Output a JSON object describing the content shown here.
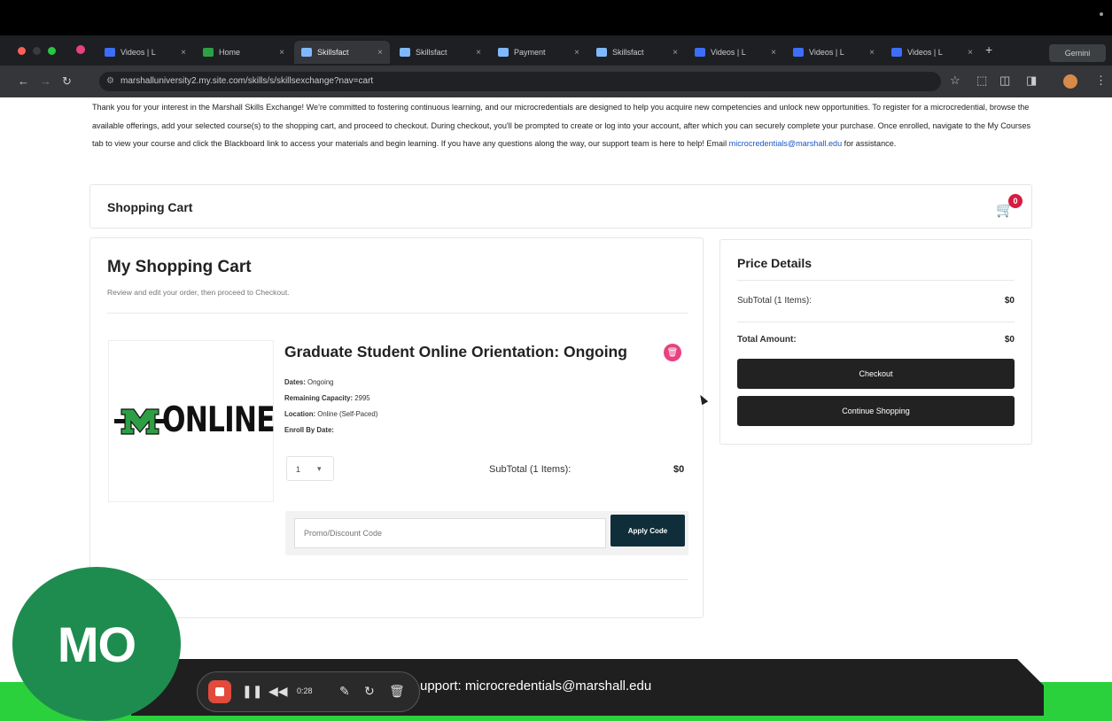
{
  "browser": {
    "tabs": [
      {
        "label": "Videos | L",
        "favicon_color": "#3d6ef7",
        "active": false
      },
      {
        "label": "Home",
        "favicon_color": "#2ea043",
        "active": false
      },
      {
        "label": "Skillsfact",
        "favicon_color": "#7fb8ff",
        "active": true
      },
      {
        "label": "Skillsfact",
        "favicon_color": "#7fb8ff",
        "active": false
      },
      {
        "label": "Payment",
        "favicon_color": "#7fb8ff",
        "active": false
      },
      {
        "label": "Skillsfact",
        "favicon_color": "#7fb8ff",
        "active": false
      },
      {
        "label": "Videos | L",
        "favicon_color": "#3d6ef7",
        "active": false
      },
      {
        "label": "Videos | L",
        "favicon_color": "#3d6ef7",
        "active": false
      },
      {
        "label": "Videos | L",
        "favicon_color": "#3d6ef7",
        "active": false
      }
    ],
    "new_tab": "+",
    "gemini_label": "Gemini",
    "url": "marshalluniversity2.my.site.com/skills/s/skillsexchange?nav=cart"
  },
  "page": {
    "intro_text": "Thank you for your interest in the Marshall Skills Exchange! We're committed to fostering continuous learning, and our microcredentials are designed to help you acquire new competencies and unlock new opportunities. To register for a microcredential, browse the available offerings, add your selected course(s) to the shopping cart, and proceed to checkout. During checkout, you'll be prompted to create or log into your account, after which you can securely complete your purchase. Once enrolled, navigate to the My Courses tab to view your course and click the Blackboard link to access your materials and begin learning. If you have any questions along the way, our support team is here to help! Email",
    "intro_email": "microcredentials@marshall.edu",
    "intro_tail": "for assistance.",
    "cart_header_title": "Shopping Cart",
    "cart_badge": "0",
    "my_cart_title": "My Shopping Cart",
    "my_cart_subtitle": "Review and edit your order, then proceed to Checkout.",
    "course": {
      "logo_text": "ONLINE",
      "title": "Graduate Student Online Orientation: Ongoing",
      "dates_label": "Dates:",
      "dates_value": "Ongoing",
      "capacity_label": "Remaining Capacity:",
      "capacity_value": "2995",
      "location_label": "Location:",
      "location_value": "Online (Self-Paced)",
      "enroll_label": "Enroll By Date:",
      "enroll_value": "",
      "quantity": "1",
      "subtotal_label": "SubTotal (1 Items):",
      "subtotal_value": "$0"
    },
    "promo_placeholder": "Promo/Discount Code",
    "apply_code_label": "Apply Code",
    "price_details": {
      "title": "Price Details",
      "subtotal_label": "SubTotal (1 Items):",
      "subtotal_value": "$0",
      "total_label": "Total Amount:",
      "total_value": "$0",
      "checkout_label": "Checkout",
      "continue_label": "Continue Shopping"
    }
  },
  "overlay": {
    "support_text": "upport: microcredentials@marshall.edu",
    "recording_time": "0:28",
    "avatar_initials": "MO"
  }
}
